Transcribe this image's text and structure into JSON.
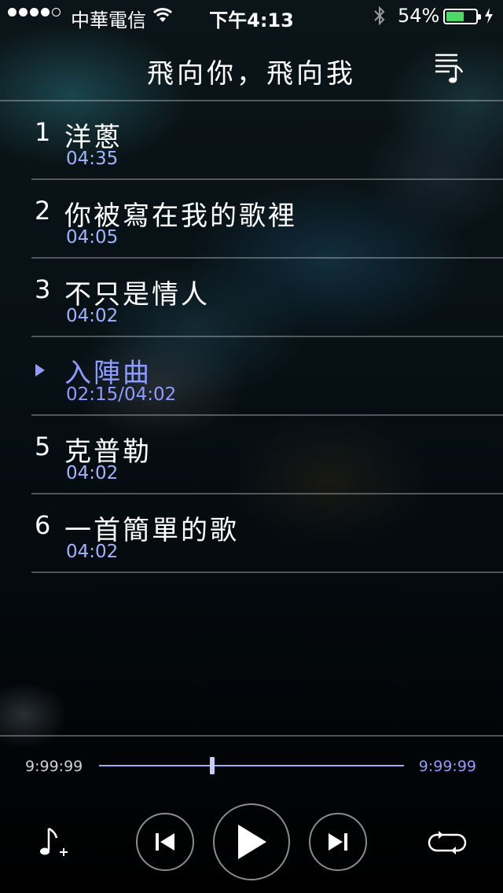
{
  "status_bar": {
    "carrier": "中華電信",
    "time": "下午4:13",
    "battery_percent": "54%",
    "battery_level": 0.54,
    "signal_bars": 4,
    "icons": [
      "wifi-icon",
      "bluetooth-icon",
      "charging-bolt-icon"
    ]
  },
  "header": {
    "title": "飛向你，飛向我",
    "menu_icon": "playlist-icon"
  },
  "tracks": [
    {
      "number": "1",
      "name": "洋蔥",
      "duration": "04:35"
    },
    {
      "number": "2",
      "name": "你被寫在我的歌裡",
      "duration": "04:05"
    },
    {
      "number": "3",
      "name": "不只是情人",
      "duration": "04:02"
    },
    {
      "number": "",
      "name": "入陣曲",
      "duration": "02:15/04:02",
      "playing": true
    },
    {
      "number": "5",
      "name": "克普勒",
      "duration": "04:02"
    },
    {
      "number": "6",
      "name": "一首簡單的歌",
      "duration": "04:02"
    }
  ],
  "player": {
    "time_left": "9:99:99",
    "time_right": "9:99:99",
    "progress": 0.37,
    "icons": [
      "add-music-icon",
      "previous-icon",
      "play-icon",
      "next-icon",
      "repeat-icon"
    ]
  },
  "colors": {
    "accent": "#8e9bff",
    "battery": "#4cd964",
    "separator": "rgba(255,255,255,0.30)"
  }
}
